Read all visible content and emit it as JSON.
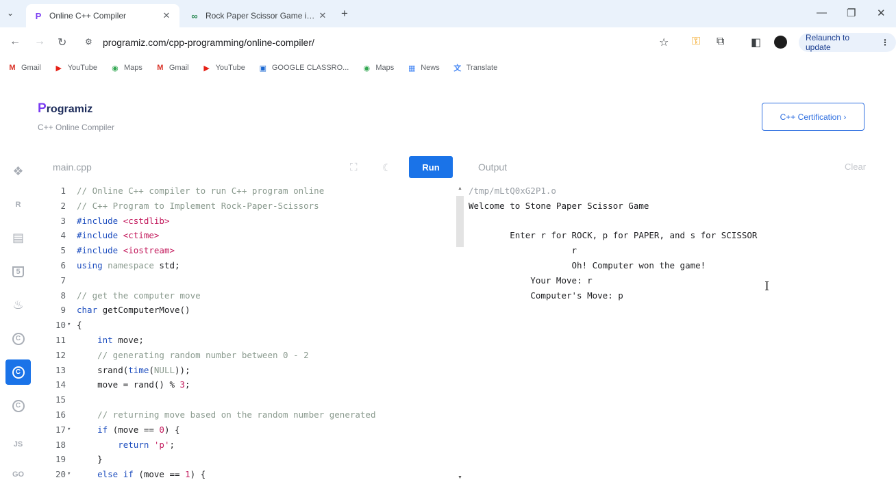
{
  "browser": {
    "tabs": [
      {
        "title": "Online C++ Compiler",
        "favicon": "P",
        "active": true
      },
      {
        "title": "Rock Paper Scissor Game in C++",
        "favicon": "∞",
        "active": false
      }
    ],
    "url": "programiz.com/cpp-programming/online-compiler/",
    "relaunch_label": "Relaunch to update",
    "bookmarks": [
      {
        "label": "Gmail",
        "icon": "M",
        "color": "#d93025"
      },
      {
        "label": "YouTube",
        "icon": "▶",
        "color": "#e62117"
      },
      {
        "label": "Maps",
        "icon": "◉",
        "color": "#34a853"
      },
      {
        "label": "Gmail",
        "icon": "M",
        "color": "#d93025"
      },
      {
        "label": "YouTube",
        "icon": "▶",
        "color": "#e62117"
      },
      {
        "label": "GOOGLE CLASSRO...",
        "icon": "▣",
        "color": "#1967d2"
      },
      {
        "label": "Maps",
        "icon": "◉",
        "color": "#34a853"
      },
      {
        "label": "News",
        "icon": "▦",
        "color": "#4285f4"
      },
      {
        "label": "Translate",
        "icon": "文",
        "color": "#4285f4"
      }
    ]
  },
  "header": {
    "logo_letter": "P",
    "logo_rest": "rogramiz",
    "subtitle": "C++ Online Compiler",
    "cert_button": "C++ Certification ›"
  },
  "editor": {
    "filename": "main.cpp",
    "run_label": "Run",
    "output_label": "Output",
    "clear_label": "Clear",
    "lines": [
      {
        "n": "1",
        "fold": "",
        "segs": [
          {
            "t": "// Online C++ compiler to run C++ program online",
            "c": "c-comment"
          }
        ]
      },
      {
        "n": "2",
        "fold": "",
        "segs": [
          {
            "t": "// C++ Program to Implement Rock-Paper-Scissors",
            "c": "c-comment"
          }
        ]
      },
      {
        "n": "3",
        "fold": "",
        "segs": [
          {
            "t": "#include ",
            "c": "c-kw"
          },
          {
            "t": "<cstdlib>",
            "c": "c-str"
          }
        ]
      },
      {
        "n": "4",
        "fold": "",
        "segs": [
          {
            "t": "#include ",
            "c": "c-kw"
          },
          {
            "t": "<ctime>",
            "c": "c-str"
          }
        ]
      },
      {
        "n": "5",
        "fold": "",
        "segs": [
          {
            "t": "#include ",
            "c": "c-kw"
          },
          {
            "t": "<iostream>",
            "c": "c-str"
          }
        ]
      },
      {
        "n": "6",
        "fold": "",
        "segs": [
          {
            "t": "using ",
            "c": "c-kw"
          },
          {
            "t": "namespace ",
            "c": "c-comment"
          },
          {
            "t": "std;",
            "c": "code"
          }
        ]
      },
      {
        "n": "7",
        "fold": "",
        "segs": [
          {
            "t": "",
            "c": "code"
          }
        ]
      },
      {
        "n": "8",
        "fold": "",
        "segs": [
          {
            "t": "// get the computer move",
            "c": "c-comment"
          }
        ]
      },
      {
        "n": "9",
        "fold": "",
        "segs": [
          {
            "t": "char ",
            "c": "c-type"
          },
          {
            "t": "getComputerMove()",
            "c": "code"
          }
        ]
      },
      {
        "n": "10",
        "fold": "▾",
        "segs": [
          {
            "t": "{",
            "c": "code"
          }
        ]
      },
      {
        "n": "11",
        "fold": "",
        "segs": [
          {
            "t": "    ",
            "c": "code"
          },
          {
            "t": "int ",
            "c": "c-type"
          },
          {
            "t": "move;",
            "c": "code"
          }
        ]
      },
      {
        "n": "12",
        "fold": "",
        "segs": [
          {
            "t": "    // generating random number between 0 - 2",
            "c": "c-comment"
          }
        ]
      },
      {
        "n": "13",
        "fold": "",
        "segs": [
          {
            "t": "    srand(",
            "c": "code"
          },
          {
            "t": "time",
            "c": "c-kw"
          },
          {
            "t": "(",
            "c": "code"
          },
          {
            "t": "NULL",
            "c": "c-comment"
          },
          {
            "t": "));",
            "c": "code"
          }
        ]
      },
      {
        "n": "14",
        "fold": "",
        "segs": [
          {
            "t": "    move = rand() % ",
            "c": "code"
          },
          {
            "t": "3",
            "c": "c-num"
          },
          {
            "t": ";",
            "c": "code"
          }
        ]
      },
      {
        "n": "15",
        "fold": "",
        "segs": [
          {
            "t": "",
            "c": "code"
          }
        ]
      },
      {
        "n": "16",
        "fold": "",
        "segs": [
          {
            "t": "    // returning move based on the random number generated",
            "c": "c-comment"
          }
        ]
      },
      {
        "n": "17",
        "fold": "▾",
        "segs": [
          {
            "t": "    ",
            "c": "code"
          },
          {
            "t": "if ",
            "c": "c-kw"
          },
          {
            "t": "(move == ",
            "c": "code"
          },
          {
            "t": "0",
            "c": "c-num"
          },
          {
            "t": ") {",
            "c": "code"
          }
        ]
      },
      {
        "n": "18",
        "fold": "",
        "segs": [
          {
            "t": "        ",
            "c": "code"
          },
          {
            "t": "return ",
            "c": "c-kw"
          },
          {
            "t": "'p'",
            "c": "c-str"
          },
          {
            "t": ";",
            "c": "code"
          }
        ]
      },
      {
        "n": "19",
        "fold": "",
        "segs": [
          {
            "t": "    }",
            "c": "code"
          }
        ]
      },
      {
        "n": "20",
        "fold": "▾",
        "segs": [
          {
            "t": "    ",
            "c": "code"
          },
          {
            "t": "else if ",
            "c": "c-kw"
          },
          {
            "t": "(move == ",
            "c": "code"
          },
          {
            "t": "1",
            "c": "c-num"
          },
          {
            "t": ") {",
            "c": "code"
          }
        ]
      }
    ]
  },
  "output": {
    "lines": [
      "/tmp/mLtQ0xG2P1.o",
      "Welcome to Stone Paper Scissor Game",
      "",
      "        Enter r for ROCK, p for PAPER, and s for SCISSOR",
      "                    r",
      "                    Oh! Computer won the game!",
      "            Your Move: r",
      "            Computer's Move: p"
    ]
  },
  "sidebar": {
    "items": [
      {
        "name": "python",
        "glyph": "❖"
      },
      {
        "name": "r",
        "glyph": "R"
      },
      {
        "name": "sql",
        "glyph": "▤"
      },
      {
        "name": "html",
        "glyph": "5"
      },
      {
        "name": "java",
        "glyph": "♨"
      },
      {
        "name": "c",
        "glyph": "C"
      },
      {
        "name": "cpp",
        "glyph": "C"
      },
      {
        "name": "csharp",
        "glyph": "C"
      },
      {
        "name": "js",
        "glyph": "JS"
      },
      {
        "name": "go",
        "glyph": "GO"
      }
    ]
  }
}
